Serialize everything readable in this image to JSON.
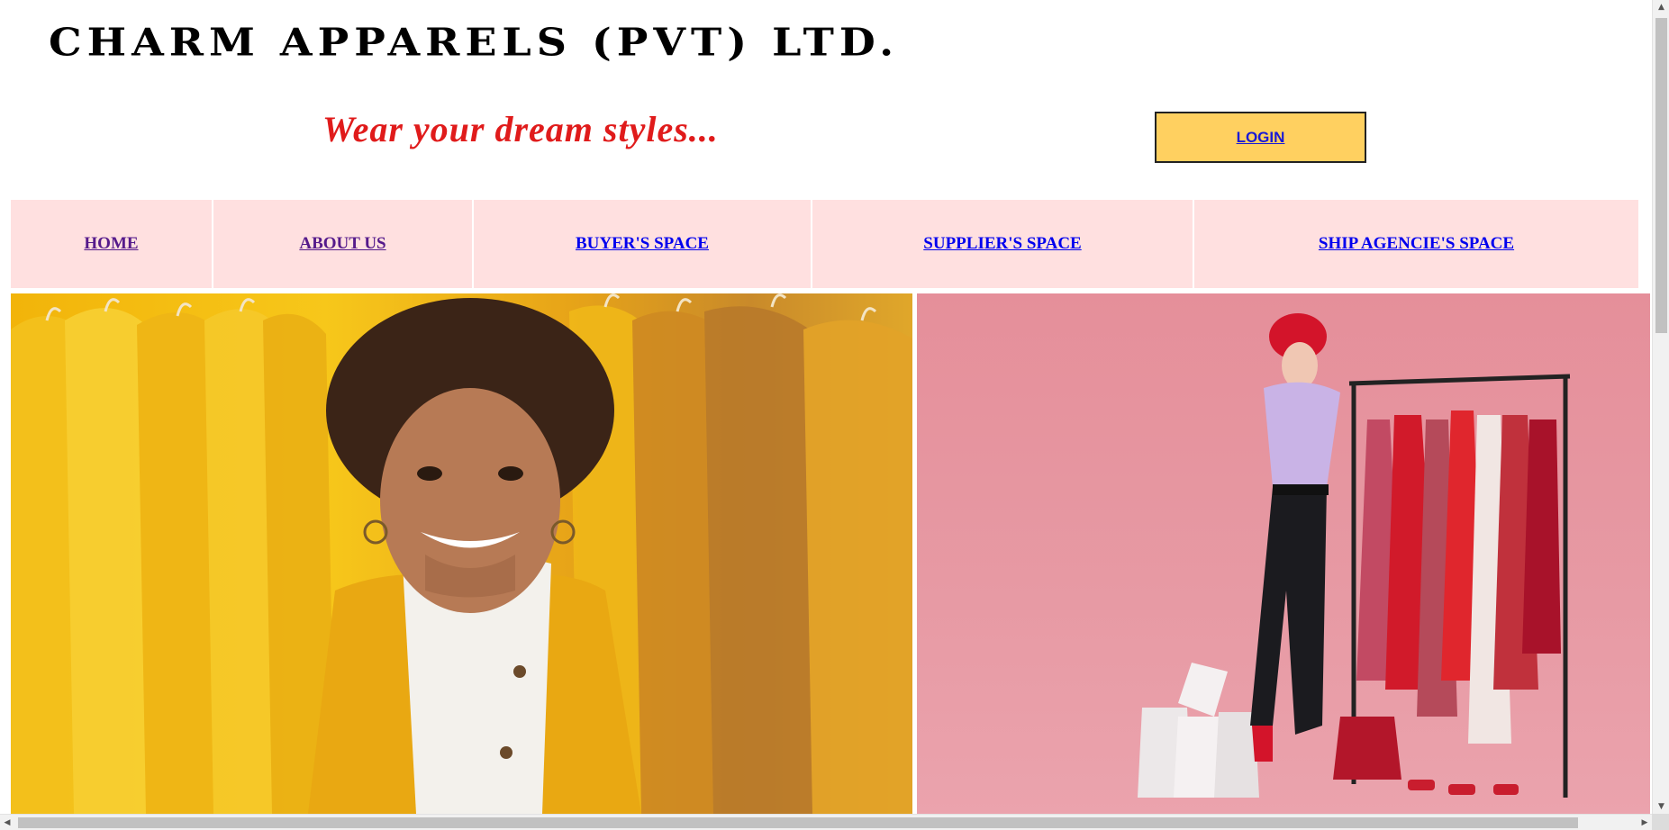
{
  "header": {
    "title": "CHARM APPARELS (PVT) LTD.",
    "tagline": "Wear your dream styles...",
    "login_label": "LOGIN"
  },
  "nav": {
    "items": [
      {
        "label": "HOME",
        "state": "visited"
      },
      {
        "label": "ABOUT US",
        "state": "visited"
      },
      {
        "label": "BUYER'S SPACE",
        "state": "link"
      },
      {
        "label": "SUPPLIER'S SPACE",
        "state": "link"
      },
      {
        "label": "SHIP AGENCIE'S SPACE",
        "state": "link"
      }
    ]
  },
  "hero": {
    "left_image": "woman-yellow-clothes-rack-photo",
    "right_image": "woman-pink-background-clothes-rack-photo"
  },
  "colors": {
    "login_bg": "#ffd060",
    "nav_bg": "#ffe0e0",
    "tagline": "#e01b1b",
    "link": "#0000ee",
    "visited": "#551a8b"
  }
}
